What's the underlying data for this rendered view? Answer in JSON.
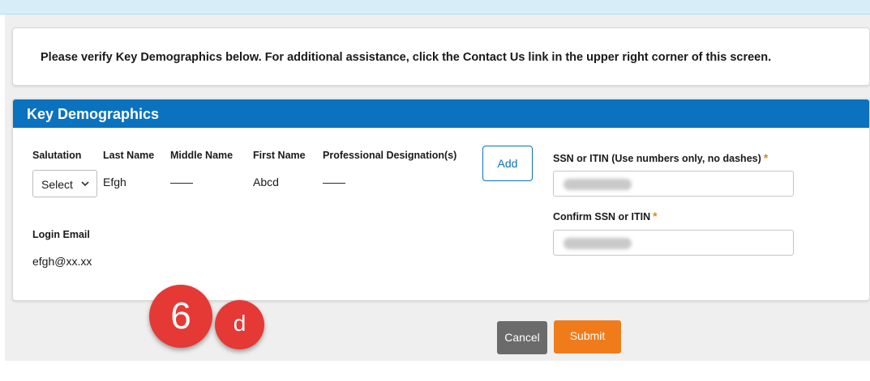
{
  "notice": {
    "text": "Please verify Key Demographics below. For additional assistance, click the Contact Us link in the upper right corner of this screen."
  },
  "key_demographics": {
    "title": "Key Demographics",
    "columns": {
      "salutation": "Salutation",
      "last_name": "Last Name",
      "middle_name": "Middle Name",
      "first_name": "First Name",
      "professional_designation": "Professional Designation(s)"
    },
    "values": {
      "salutation_selected": "Select",
      "last_name": "Efgh",
      "middle_name": "——",
      "first_name": "Abcd",
      "professional_designation": "——"
    },
    "add_label": "Add",
    "ssn_label": "SSN or ITIN (Use numbers only, no dashes)",
    "confirm_ssn_label": "Confirm SSN or ITIN",
    "required_marker": "*",
    "login_email_label": "Login Email",
    "login_email_value": "efgh@xx.xx"
  },
  "actions": {
    "cancel_label": "Cancel",
    "submit_label": "Submit"
  },
  "annotations": {
    "step_number": "6",
    "step_letter": "d"
  },
  "colors": {
    "header_blue": "#0b72bf",
    "submit_orange": "#f07b1b",
    "cancel_gray": "#6b6b6b",
    "badge_red": "#e53935",
    "required_star": "#d28a1a"
  }
}
